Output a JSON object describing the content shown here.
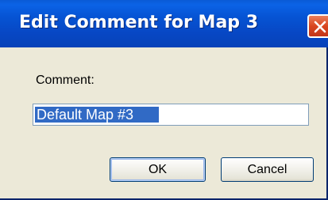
{
  "window": {
    "title": "Edit Comment for Map 3",
    "close_icon": "close-icon"
  },
  "form": {
    "comment_label": "Comment:",
    "comment_value": "Default Map #3"
  },
  "buttons": {
    "ok_label": "OK",
    "cancel_label": "Cancel"
  },
  "colors": {
    "titlebar": "#0654d4",
    "dialog_bg": "#ece9d8",
    "selection": "#316ac5",
    "close_button": "#d9461f"
  }
}
